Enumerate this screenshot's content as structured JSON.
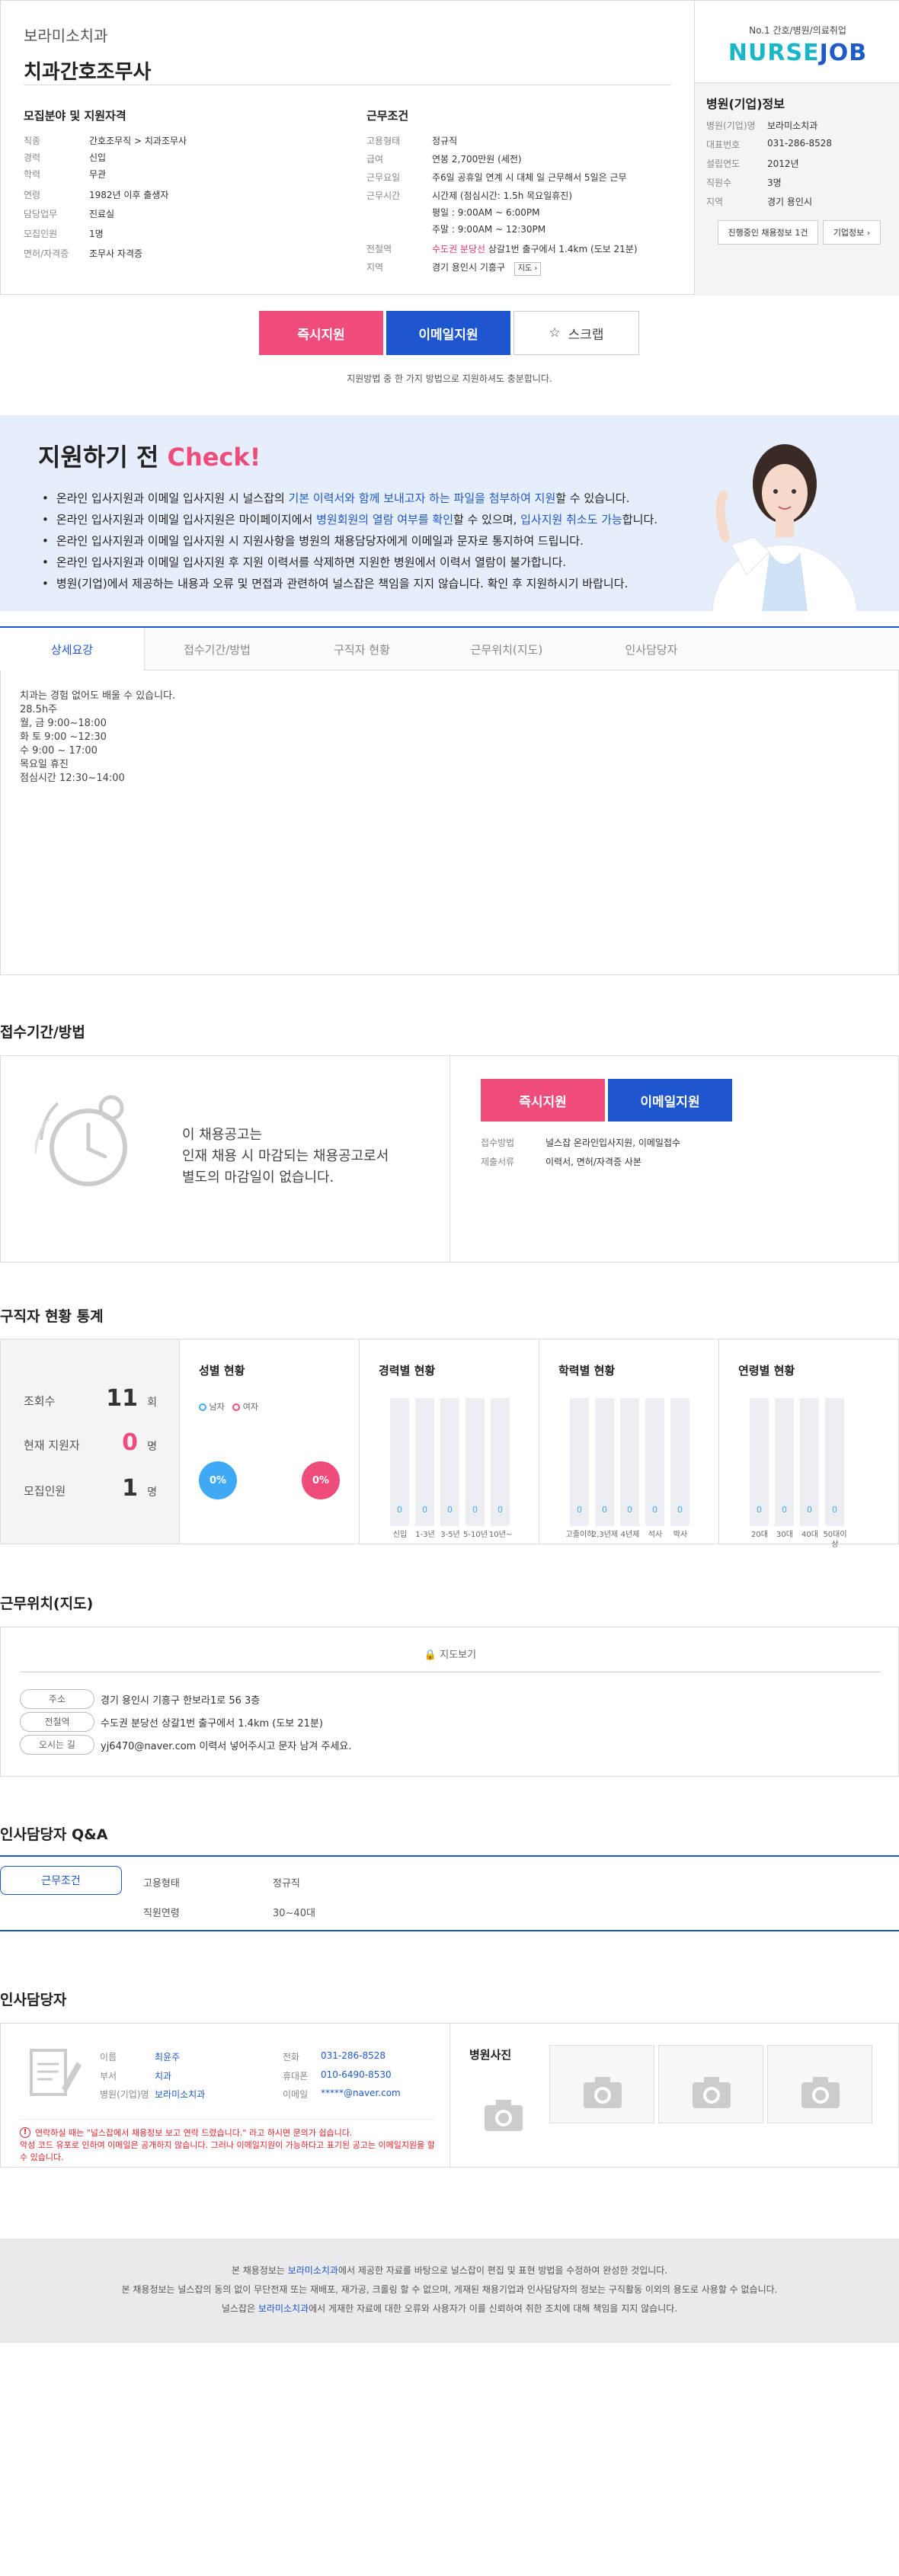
{
  "header": {
    "company": "보라미소치과",
    "title": "치과간호조무사"
  },
  "qualification": {
    "heading": "모집분야 및 지원자격",
    "rows": [
      {
        "k": "직종",
        "v": "간호조무직 > 치과조무사"
      },
      {
        "k": "경력",
        "v": "신입"
      },
      {
        "k": "학력",
        "v": "무관"
      },
      {
        "k": "연령",
        "v": "1982년 이후 출생자"
      },
      {
        "k": "담당업무",
        "v": "진료실"
      },
      {
        "k": "모집인원",
        "v": "1명"
      },
      {
        "k": "면허/자격증",
        "v": "조무사 자격증"
      }
    ]
  },
  "conditions": {
    "heading": "근무조건",
    "employment_k": "고용형태",
    "employment_v": "정규직",
    "salary_k": "급여",
    "salary_v": "연봉 2,700만원 (세전)",
    "days_k": "근무요일",
    "days_v": "주6일 공휴일 연계 시 대체 일 근무해서 5일은 근무",
    "hours_k": "근무시간",
    "hours_v1": "시간제 (점심시간: 1.5h 목요일휴진)",
    "hours_v2": "평일 : 9:00AM ~ 6:00PM",
    "hours_v3": "주말 : 9:00AM ~ 12:30PM",
    "station_k": "전철역",
    "station_v1": "수도권 분당선",
    "station_v2": " 상갈1번 출구에서 1.4km (도보 21분)",
    "region_k": "지역",
    "region_v": "경기 용인시 기흥구",
    "map_label": "지도"
  },
  "brand": {
    "tagline": "No.1 간호/병원/의료취업",
    "logo_part1": "NURSE",
    "logo_part2": "JOB"
  },
  "hospital": {
    "heading": "병원(기업)정보",
    "rows": [
      {
        "k": "병원(기업)명",
        "v": "보라미소치과"
      },
      {
        "k": "대표번호",
        "v": "031-286-8528"
      },
      {
        "k": "설립연도",
        "v": "2012년"
      },
      {
        "k": "직원수",
        "v": "3명"
      },
      {
        "k": "지역",
        "v": "경기 용인시"
      }
    ],
    "btn_jobs": "진행중인 채용정보 1건",
    "btn_jobs_count": "1건",
    "btn_info": "기업정보"
  },
  "apply": {
    "instant": "즉시지원",
    "email": "이메일지원",
    "scrap": "스크랩",
    "note": "지원방법 중 한 가지 방법으로 지원하셔도 충분합니다."
  },
  "check": {
    "title_a": "지원하기 전 ",
    "title_b": "Check!",
    "items": [
      {
        "a": "온라인 입사지원과 이메일 입사지원 시 널스잡의 ",
        "b": "기본 이력서와 함께 보내고자 하는 파일을 첨부하여 지원",
        "c": "할 수 있습니다."
      },
      {
        "a": "온라인 입사지원과 이메일 입사지원은 마이페이지에서 ",
        "b": "병원회원의 열람 여부를 확인",
        "c": "할 수 있으며, ",
        "d": "입사지원 취소도 가능",
        "e": "합니다."
      },
      {
        "a": "온라인 입사지원과 이메일 입사지원 시 지원사항을 병원의 채용담당자에게 이메일과 문자로 통지하여 드립니다."
      },
      {
        "a": "온라인 입사지원과 이메일 입사지원 후 지원 이력서를 삭제하면 지원한 병원에서 이력서 열람이 불가합니다."
      },
      {
        "a": "병원(기업)에서 제공하는 내용과 오류 및 면접과 관련하여 널스잡은 책임을 지지 않습니다. 확인 후 지원하시기 바랍니다."
      }
    ]
  },
  "tabs": [
    "상세요강",
    "접수기간/방법",
    "구직자 현황",
    "근무위치(지도)",
    "인사담당자"
  ],
  "detail": {
    "lines": [
      "치과는 경험 없어도 배울 수 있습니다.",
      "28.5h주",
      "월, 금 9:00~18:00",
      "화 토  9:00 ~12:30",
      "수 9:00 ~ 17:00",
      "목요일 휴진",
      "점심시간 12:30~14:00"
    ]
  },
  "deadline": {
    "title": "접수기간/방법",
    "text1": "이 채용공고는",
    "text2": "인재 채용 시 마감되는 채용공고로서",
    "text3": "별도의 마감일이 없습니다.",
    "method_k": "접수방법",
    "method_v": "널스잡 온라인입사지원, 이메일접수",
    "docs_k": "제출서류",
    "docs_v": "이력서, 면허/자격증 사본"
  },
  "stats": {
    "title": "구직자 현황 통계",
    "views_label": "조회수",
    "views": "11",
    "views_unit": "회",
    "applicants_label": "현재 지원자",
    "applicants": "0",
    "applicants_unit": "명",
    "openings_label": "모집인원",
    "openings": "1",
    "openings_unit": "명",
    "gender_title": "성별 현황",
    "male": "남자",
    "female": "여자",
    "male_pct": "0%",
    "female_pct": "0%",
    "career_title": "경력별 현황",
    "career": [
      {
        "l": "신입",
        "v": "0"
      },
      {
        "l": "1-3년",
        "v": "0"
      },
      {
        "l": "3-5년",
        "v": "0"
      },
      {
        "l": "5-10년",
        "v": "0"
      },
      {
        "l": "10년~",
        "v": "0"
      }
    ],
    "edu_title": "학력별 현황",
    "edu": [
      {
        "l": "고졸이하",
        "v": "0"
      },
      {
        "l": "2,3년제",
        "v": "0"
      },
      {
        "l": "4년제",
        "v": "0"
      },
      {
        "l": "석사",
        "v": "0"
      },
      {
        "l": "박사",
        "v": "0"
      }
    ],
    "age_title": "연령별 현황",
    "age": [
      {
        "l": "20대",
        "v": "0"
      },
      {
        "l": "30대",
        "v": "0"
      },
      {
        "l": "40대",
        "v": "0"
      },
      {
        "l": "50대이상",
        "v": "0"
      }
    ]
  },
  "map": {
    "title": "근무위치(지도)",
    "view": "지도보기",
    "addr_k": "주소",
    "addr_v": "경기 용인시 기흥구 한보라1로 56 3층",
    "station_k": "전철역",
    "station_v": "수도권 분당선 상갈1번 출구에서 1.4km (도보 21분)",
    "route_k": "오시는 길",
    "route_v": "yj6470@naver.com 이력서 넣어주시고 문자 남겨 주세요."
  },
  "qa": {
    "title": "인사담당자 Q&A",
    "tab": "근무조건",
    "r1k": "고용형태",
    "r1v": "정규직",
    "r2k": "직원연령",
    "r2v": "30~40대"
  },
  "manager": {
    "title": "인사담당자",
    "name_k": "이름",
    "name_v": "최윤주",
    "dept_k": "부서",
    "dept_v": "치과",
    "hosp_k": "병원(기업)명",
    "hosp_v": "보라미소치과",
    "tel_k": "전화",
    "tel_v": "031-286-8528",
    "mobile_k": "휴대폰",
    "mobile_v": "010-6490-8530",
    "email_k": "이메일",
    "email_v": "*****@naver.com",
    "warn1": "연락하실 때는 \"널스잡에서 채용정보 보고 연락 드렸습니다.\" 라고 하시면 문의가 쉽습니다.",
    "warn2": "악성 코드 유포로 인하여 이메일은 공개하지 않습니다. 그러나 이메일지원이 가능하다고 표기된 공고는 이메일지원을 할 수 있습니다.",
    "photos_title": "병원사진"
  },
  "footer": {
    "l1a": "본 채용정보는 ",
    "l1b": "보라미소치과",
    "l1c": "에서 제공한 자료를 바탕으로 널스잡이 편집 및 표현 방법을 수정하여 완성한 것입니다.",
    "l2": "본 채용정보는 널스잡의 동의 없이 무단전재 또는 재배포, 재가공, 크롤링 할 수 없으며, 게재된 채용기업과 인사담당자의 정보는 구직활동 이외의 용도로 사용할 수 없습니다.",
    "l3a": "널스잡은 ",
    "l3b": "보라미소치과",
    "l3c": "에서 게재한 자료에 대한 오류와 사용자가 이를 신뢰하여 취한 조치에 대해 책임을 지지 않습니다."
  },
  "colors": {
    "blue": "#1e56d0",
    "pink": "#ee4c7a",
    "teal": "#19b6c8"
  }
}
